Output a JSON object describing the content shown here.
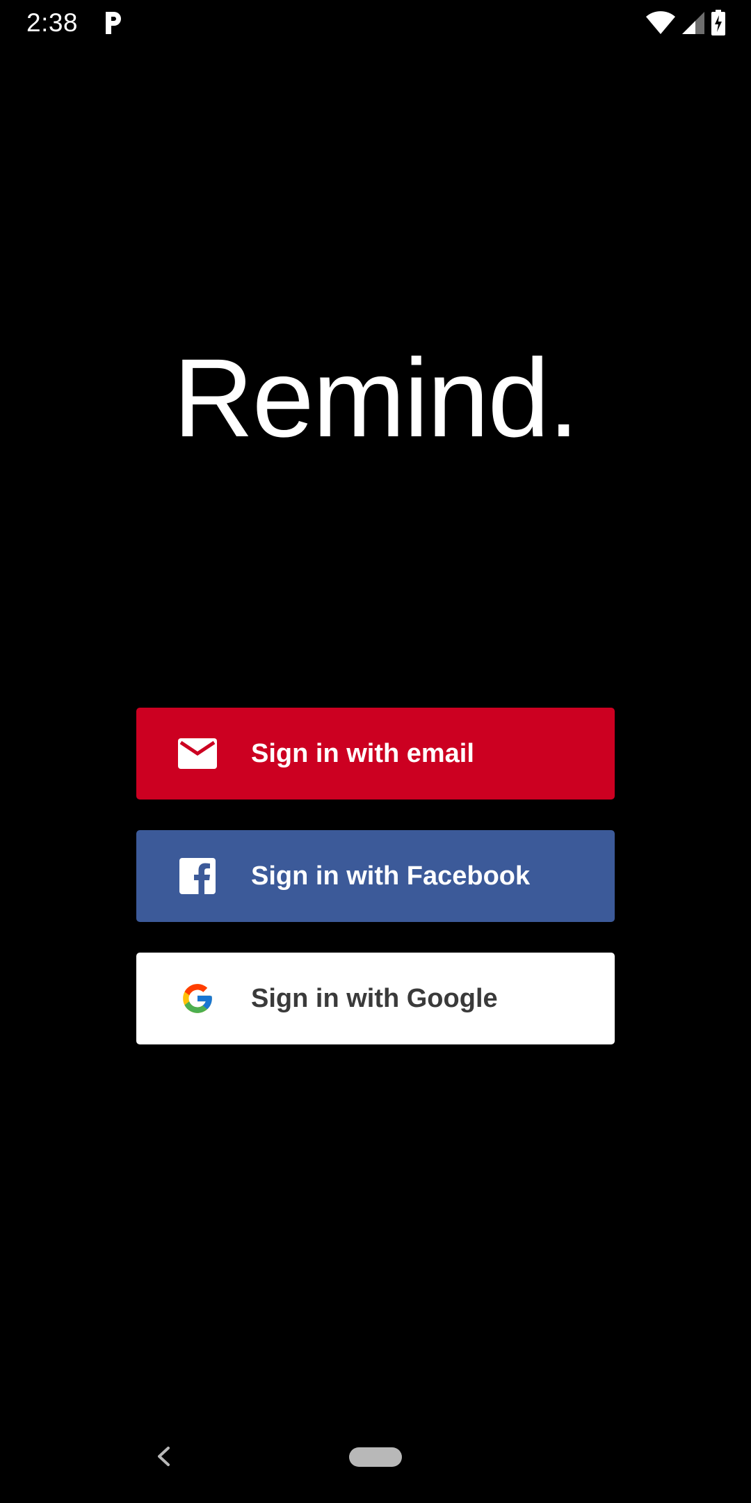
{
  "status_bar": {
    "time": "2:38",
    "app_icon": "pandora-p-icon",
    "wifi_icon": "wifi-icon",
    "signal_icon": "cell-signal-icon",
    "battery_icon": "battery-charging-icon"
  },
  "logo": {
    "text": "Remind."
  },
  "buttons": {
    "email": {
      "label": "Sign in with email",
      "icon": "mail-icon",
      "color": "#cc0021"
    },
    "facebook": {
      "label": "Sign in with Facebook",
      "icon": "facebook-icon",
      "color": "#3c5a99"
    },
    "google": {
      "label": "Sign in with Google",
      "icon": "google-icon",
      "color": "#ffffff"
    }
  },
  "nav_bar": {
    "back_icon": "back-chevron-icon",
    "home_icon": "home-pill-icon"
  }
}
